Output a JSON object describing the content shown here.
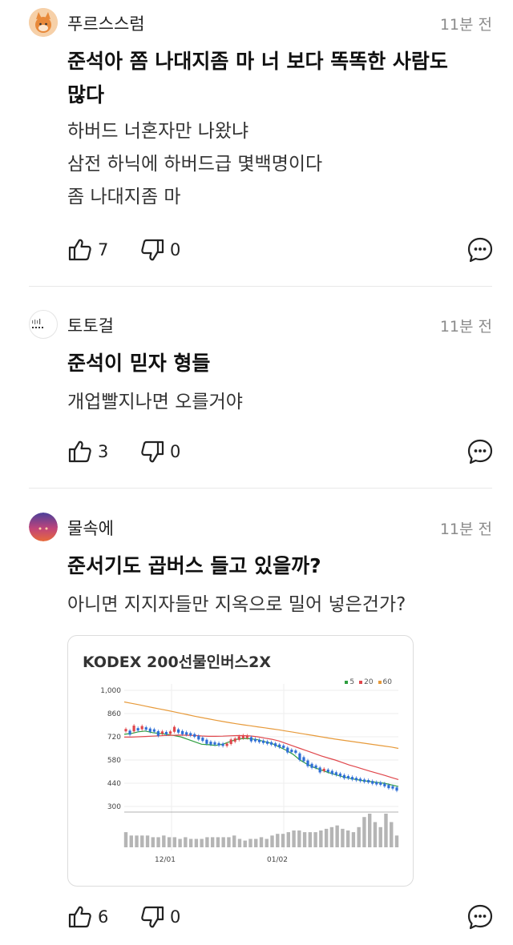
{
  "comments": [
    {
      "nickname": "푸르스스럼",
      "time": "11분 전",
      "title_line1": "준석아 쫌 나대지좀 마 너 보다 똑똑한 사람도",
      "title_line2": "많다",
      "body": [
        "하버드 너혼자만 나왔냐",
        "삼전 하닉에 하버드급 몇백명이다",
        "좀 나대지좀 마"
      ],
      "likes": "7",
      "dislikes": "0"
    },
    {
      "nickname": "토토걸",
      "time": "11분 전",
      "title_line1": "준석이 믿자 형들",
      "body": [
        "개업빨지나면 오를거야"
      ],
      "likes": "3",
      "dislikes": "0"
    },
    {
      "nickname": "물속에",
      "time": "11분 전",
      "title_line1": "준서기도 곱버스 들고 있을까?",
      "body": [
        "아니면 지지자들만 지옥으로 밀어 넣은건가?"
      ],
      "likes": "6",
      "dislikes": "0",
      "attachment": {
        "title": "KODEX 200선물인버스2X",
        "legend": [
          "5",
          "20",
          "60"
        ],
        "legend_colors": [
          "#2e9e3f",
          "#e0474c",
          "#e79a3a"
        ]
      }
    }
  ],
  "chart_data": {
    "type": "line",
    "title": "KODEX 200선물인버스2X",
    "ylim": [
      300,
      1000
    ],
    "y_ticks": [
      "1,000",
      "860",
      "720",
      "580",
      "440",
      "300"
    ],
    "x_ticks": [
      "12/01",
      "01/02"
    ],
    "series": [
      {
        "name": "5",
        "color": "#2e9e3f",
        "values": [
          735,
          740,
          750,
          755,
          745,
          740,
          735,
          728,
          720,
          705,
          690,
          675,
          672,
          668,
          675,
          690,
          705,
          710,
          708,
          702,
          690,
          680,
          660,
          640,
          615,
          580,
          555,
          535,
          520,
          505,
          492,
          480,
          470,
          462,
          455,
          450,
          445,
          440,
          430,
          420
        ]
      },
      {
        "name": "20",
        "color": "#e0474c",
        "values": [
          718,
          718,
          720,
          722,
          724,
          726,
          728,
          729,
          730,
          729,
          728,
          725,
          723,
          723,
          724,
          726,
          727,
          727,
          725,
          720,
          712,
          705,
          695,
          680,
          665,
          650,
          635,
          620,
          605,
          592,
          580,
          565,
          550,
          538,
          525,
          512,
          500,
          488,
          475,
          462
        ]
      },
      {
        "name": "60",
        "color": "#e79a3a",
        "values": [
          930,
          922,
          914,
          905,
          896,
          888,
          880,
          871,
          862,
          853,
          844,
          836,
          828,
          820,
          812,
          805,
          798,
          792,
          786,
          780,
          774,
          768,
          762,
          755,
          748,
          741,
          734,
          727,
          720,
          713,
          706,
          700,
          694,
          688,
          682,
          676,
          670,
          664,
          658,
          650
        ]
      }
    ],
    "candles": [
      760,
      745,
      770,
      765,
      775,
      770,
      760,
      758,
      740,
      745,
      742,
      745,
      765,
      755,
      745,
      740,
      735,
      728,
      715,
      705,
      690,
      682,
      680,
      675,
      672,
      672,
      690,
      700,
      712,
      720,
      720,
      705,
      700,
      695,
      690,
      685,
      680,
      672,
      665,
      660,
      640,
      635,
      630,
      600,
      585,
      560,
      545,
      540,
      520,
      520,
      515,
      505,
      498,
      490,
      480,
      476,
      470,
      465,
      460,
      455,
      452,
      445,
      440,
      438,
      430,
      420,
      415,
      405
    ],
    "volumes": [
      9,
      7,
      7,
      7,
      7,
      6,
      6,
      7,
      6,
      6,
      5,
      6,
      5,
      5,
      5,
      6,
      6,
      6,
      6,
      6,
      7,
      5,
      4,
      5,
      5,
      6,
      5,
      7,
      8,
      8,
      9,
      10,
      10,
      9,
      9,
      9,
      10,
      11,
      12,
      13,
      11,
      10,
      9,
      12,
      18,
      20,
      15,
      12,
      20,
      15,
      7
    ]
  }
}
